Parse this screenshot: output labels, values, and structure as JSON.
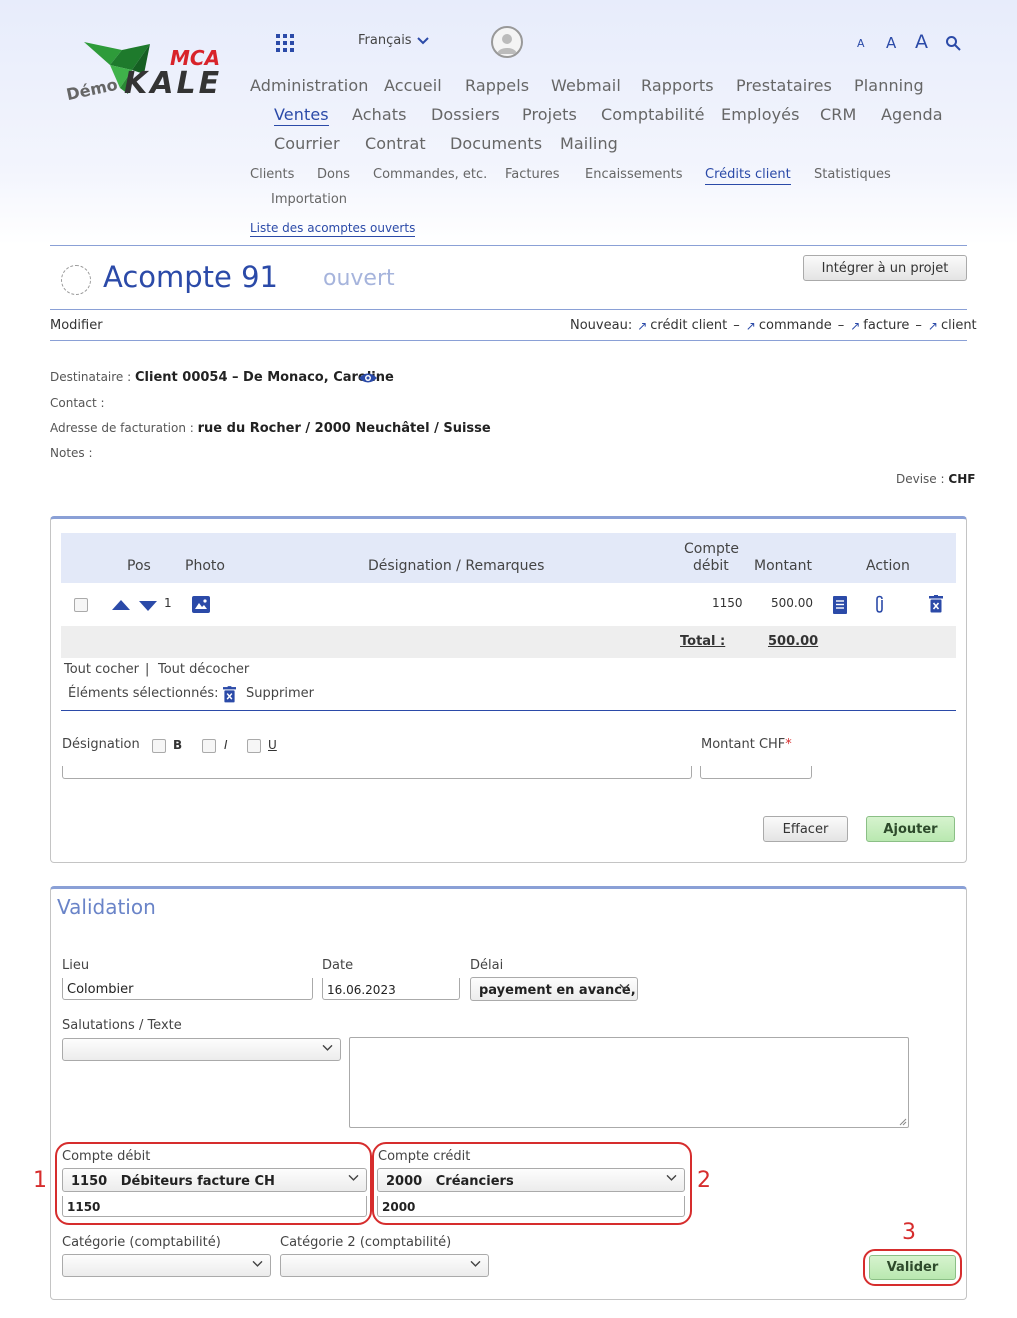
{
  "header": {
    "logo": {
      "brand_top": "MCA",
      "brand_main": "KALE",
      "prefix": "Démo"
    },
    "language": "Français",
    "font_sizes": [
      "A",
      "A",
      "A"
    ]
  },
  "nav": {
    "row1": [
      "Administration",
      "Accueil",
      "Rappels",
      "Webmail",
      "Rapports",
      "Prestataires",
      "Planning"
    ],
    "row2": [
      "Ventes",
      "Achats",
      "Dossiers",
      "Projets",
      "Comptabilité",
      "Employés",
      "CRM",
      "Agenda"
    ],
    "row3": [
      "Courrier",
      "Contrat",
      "Documents",
      "Mailing"
    ]
  },
  "subnav": {
    "items": [
      "Clients",
      "Dons",
      "Commandes, etc.",
      "Factures",
      "Encaissements",
      "Crédits client",
      "Statistiques"
    ],
    "import": "Importation",
    "list_link": "Liste des acomptes ouverts"
  },
  "title": {
    "text": "Acompte 91",
    "status": "ouvert",
    "project_button": "Intégrer à un projet"
  },
  "actions": {
    "modify": "Modifier",
    "new_label": "Nouveau:",
    "new_items": [
      "crédit client",
      "commande",
      "facture",
      "client"
    ]
  },
  "info": {
    "recipient_label": "Destinataire :",
    "recipient_value": "Client 00054 – De Monaco, Caroline",
    "contact_label": "Contact :",
    "address_label": "Adresse de facturation :",
    "address_value": "rue du Rocher / 2000 Neuchâtel / Suisse",
    "notes_label": "Notes :",
    "currency_label": "Devise :",
    "currency_value": "CHF"
  },
  "table": {
    "headers": {
      "pos": "Pos",
      "photo": "Photo",
      "designation": "Désignation / Remarques",
      "account_line1": "Compte",
      "account_line2": "débit",
      "amount": "Montant",
      "action": "Action"
    },
    "rows": [
      {
        "pos": "1",
        "account": "1150",
        "amount": "500.00"
      }
    ],
    "total_label": "Total :",
    "total_value": "500.00",
    "check_all": "Tout cocher",
    "uncheck_all": "Tout décocher",
    "selected_label": "Éléments sélectionnés:",
    "delete_label": "Supprimer"
  },
  "form": {
    "designation_label": "Désignation",
    "bold": "B",
    "italic": "I",
    "underline": "U",
    "amount_label": "Montant CHF",
    "required_mark": "*",
    "clear_button": "Effacer",
    "add_button": "Ajouter"
  },
  "validation": {
    "title": "Validation",
    "place_label": "Lieu",
    "place_value": "Colombier",
    "date_label": "Date",
    "date_value": "16.06.2023",
    "deadline_label": "Délai",
    "deadline_value": "payement en avance,",
    "salutation_label": "Salutations / Texte",
    "debit_label": "Compte débit",
    "debit_select": "1150   Débiteurs facture CH",
    "debit_value": "1150",
    "credit_label": "Compte crédit",
    "credit_select": "2000   Créanciers",
    "credit_value": "2000",
    "category_label": "Catégorie (comptabilité)",
    "category2_label": "Catégorie 2 (comptabilité)",
    "submit_button": "Valider"
  },
  "annotations": {
    "n1": "1",
    "n2": "2",
    "n3": "3"
  },
  "colors": {
    "accent": "#2b4aa8",
    "annotation": "#d62d2d",
    "green_button": "#c6eebd"
  }
}
